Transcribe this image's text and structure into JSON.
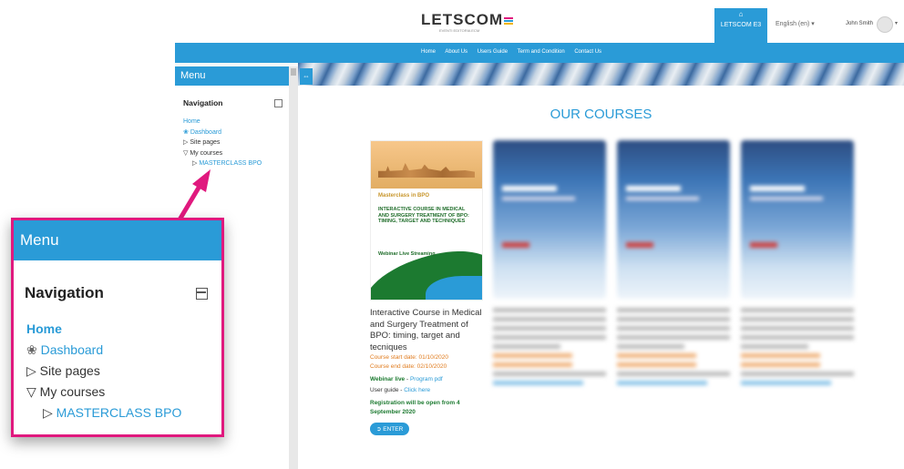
{
  "header": {
    "logo_text": "LETSCOM",
    "logo_sub": "EVENTI  EDITORIA  ECM",
    "brand_button": "LETSCOM E3",
    "language": "English (en) ▾",
    "user_name": "John Smith",
    "user_caret": "▾"
  },
  "navbar": {
    "links": [
      "Home",
      "About Us",
      "Users Guide",
      "Term and Condition",
      "Contact Us"
    ]
  },
  "sidebar": {
    "header": "Menu",
    "collapse_symbol": "⇔",
    "nav_title": "Navigation",
    "home": "Home",
    "dashboard": "Dashboard",
    "site_pages": "Site pages",
    "my_courses": "My courses",
    "masterclass": "MASTERCLASS BPO"
  },
  "main": {
    "heading": "OUR COURSES",
    "course": {
      "poster_kicker": "Masterclass in BPO",
      "poster_title": "INTERACTIVE COURSE IN MEDICAL AND SURGERY TREATMENT OF BPO: TIMING, TARGET AND TECHNIQUES",
      "poster_sub": "Webinar Live Streaming",
      "title": "Interactive Course in Medical and Surgery Treatment of BPO: timing, target and tecniques",
      "start_date": "Course start date: 01/10/2020",
      "end_date": "Course end date: 02/10/2020",
      "webinar_label": "Webinar live",
      "webinar_link": "Program pdf",
      "guide_label": "User guide",
      "guide_link": "Click here",
      "registration": "Registration will be open from 4 September 2020",
      "enter_button": "ENTER"
    }
  },
  "zoom": {
    "header": "Menu",
    "nav_title": "Navigation",
    "home": "Home",
    "dashboard": "Dashboard",
    "site_pages": "Site pages",
    "my_courses": "My courses",
    "masterclass": "MASTERCLASS BPO"
  },
  "colors": {
    "accent": "#2a9bd7",
    "callout_border": "#e0197e",
    "date_orange": "#e07b1d",
    "green": "#1c7a30"
  }
}
